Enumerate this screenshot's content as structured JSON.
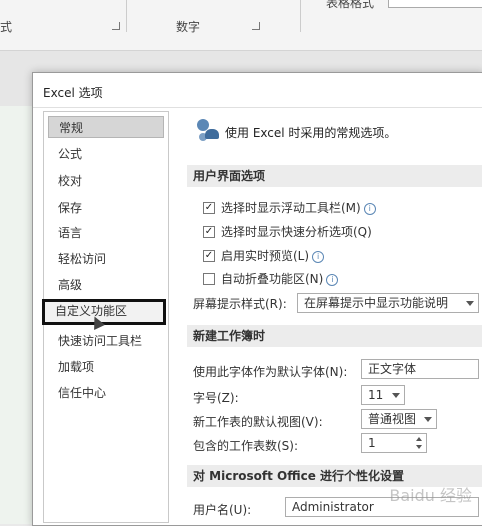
{
  "ribbon": {
    "group_left": "式",
    "group_number": "数字",
    "table_format": "表格格式"
  },
  "dialog": {
    "title": "Excel 选项",
    "nav": [
      "常规",
      "公式",
      "校对",
      "保存",
      "语言",
      "轻松访问",
      "高级",
      "自定义功能区",
      "快速访问工具栏",
      "加载项",
      "信任中心"
    ],
    "selected_nav": "常规",
    "highlighted_nav": "自定义功能区"
  },
  "content": {
    "header": "使用 Excel 时采用的常规选项。",
    "ui_section": "用户界面选项",
    "options": [
      {
        "label": "选择时显示浮动工具栏(M)",
        "checked": true,
        "info": true
      },
      {
        "label": "选择时显示快速分析选项(Q)",
        "checked": true,
        "info": false
      },
      {
        "label": "启用实时预览(L)",
        "checked": true,
        "info": true
      },
      {
        "label": "自动折叠功能区(N)",
        "checked": false,
        "info": true
      }
    ],
    "screentip_label": "屏幕提示样式(R):",
    "screentip_value": "在屏幕提示中显示功能说明",
    "new_wb_section": "新建工作簿时",
    "font_label": "使用此字体作为默认字体(N):",
    "font_value": "正文字体",
    "size_label": "字号(Z):",
    "size_value": "11",
    "view_label": "新工作表的默认视图(V):",
    "view_value": "普通视图",
    "sheets_label": "包含的工作表数(S):",
    "sheets_value": "1",
    "office_section": "对 Microsoft Office 进行个性化设置",
    "username_label": "用户名(U):",
    "username_value": "Administrator"
  },
  "watermark": "Baidu 经验"
}
